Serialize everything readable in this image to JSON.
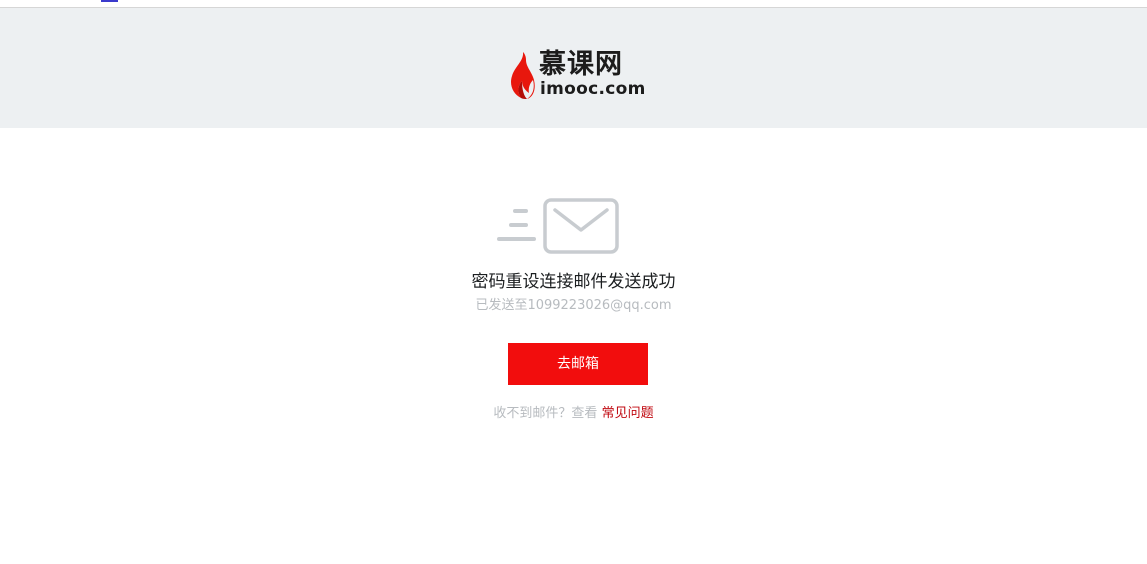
{
  "header": {
    "logo_cn": "慕课网",
    "logo_en": "imooc.com"
  },
  "main": {
    "title": "密码重设连接邮件发送成功",
    "sent_to": "已发送至1099223026@qq.com",
    "go_button": "去邮箱",
    "help_prefix": "收不到邮件？查看",
    "help_link": "常见问题"
  },
  "colors": {
    "header_bg": "#edf0f2",
    "button": "#f20d0d",
    "link": "#c0070f",
    "muted": "#b7bbbf"
  },
  "icons": {
    "logo": "flame-logo-icon",
    "mail": "envelope-icon"
  }
}
